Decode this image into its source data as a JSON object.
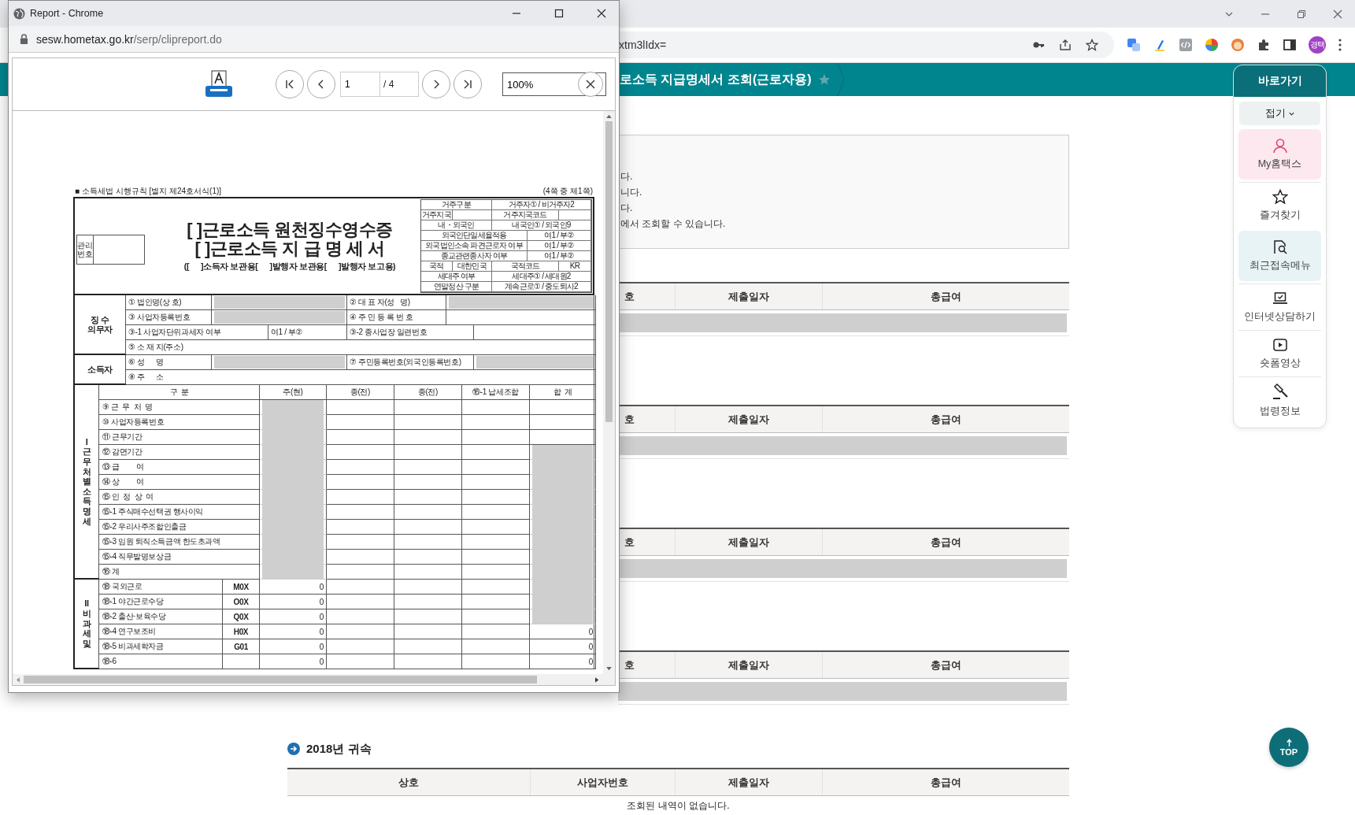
{
  "browser": {
    "address": "xtm3lIdx=",
    "profile": "경택"
  },
  "page": {
    "title": "로소득 지급명세서 조회(근로자용)",
    "notice_lines": [
      "다.",
      "니다.",
      "다.",
      "에서 조회할 수 있습니다."
    ],
    "tables": [
      {
        "columns": [
          "호",
          "제출일자",
          "총급여"
        ],
        "rows": [
          {
            "redacted": true
          }
        ]
      },
      {
        "columns": [
          "호",
          "제출일자",
          "총급여"
        ],
        "rows": [
          {
            "redacted": true
          }
        ]
      },
      {
        "columns": [
          "호",
          "제출일자",
          "총급여"
        ],
        "rows": [
          {
            "redacted": true
          }
        ]
      },
      {
        "columns": [
          "호",
          "제출일자",
          "총급여"
        ],
        "rows": [
          {
            "redacted": true
          }
        ]
      }
    ],
    "section": {
      "title": "2018년 귀속",
      "columns": [
        "상호",
        "사업자번호",
        "제출일자",
        "총급여"
      ],
      "empty_message": "조회된 내역이 없습니다."
    }
  },
  "quick_menu": {
    "title": "바로가기",
    "toggle": "접기",
    "items": [
      {
        "kind": "person",
        "label": "My홈택스",
        "color": "#fce8ee"
      },
      {
        "kind": "star",
        "label": "즐겨찾기"
      },
      {
        "kind": "recent",
        "label": "최근접속메뉴",
        "color": "#e7f3f4"
      },
      {
        "kind": "laptop",
        "label": "인터넷상담하기"
      },
      {
        "kind": "play",
        "label": "숏폼영상"
      },
      {
        "kind": "gavel",
        "label": "법령정보"
      }
    ]
  },
  "top_button": "TOP",
  "popup": {
    "title": "Report - Chrome",
    "url_host": "sesw.hometax.go.kr",
    "url_path": "/serp/clipreport.do",
    "page_input": "1",
    "page_total": "/ 4",
    "zoom": "100%",
    "document": {
      "form_ref": "■ 소득세법 시행규칙 [별지 제24호서식(1)]",
      "page_note": "(4쪽 중 제1쪽)",
      "mgmt_label": "관리 번호",
      "titles": [
        "[ ]근로소득 원천징수영수증",
        "[ ]근로소득 지 급 명 세 서"
      ],
      "copy_line": "([      ]소득자 보관용[      ]발행자 보관용[      ]발행자 보고용)",
      "status_grid": [
        {
          "kind": "half",
          "cells": [
            "거주구분",
            "거주자① / 비거주자2"
          ]
        },
        {
          "kind": "label_pair",
          "cells": [
            "거주지국",
            "거주지국코드"
          ]
        },
        {
          "kind": "half",
          "cells": [
            "내・외국인",
            "내국인① / 외국인9"
          ]
        },
        {
          "kind": "flag",
          "cells": [
            "외국인단일세율적용",
            "여1 / 부②"
          ]
        },
        {
          "kind": "flag",
          "cells": [
            "외국법인소속 파견근로자 여부",
            "여1 / 부②"
          ]
        },
        {
          "kind": "flag",
          "cells": [
            "종교관련종사자 여부",
            "여1 / 부②"
          ]
        },
        {
          "kind": "quad",
          "cells": [
            "국적",
            "대한민국",
            "국적코드",
            "KR"
          ]
        },
        {
          "kind": "half",
          "cells": [
            "세대주 여부",
            "세대주① / 세대원2"
          ]
        },
        {
          "kind": "half",
          "cells": [
            "연말정산 구분",
            "계속근로① / 중도퇴사2"
          ]
        }
      ],
      "parties": [
        {
          "label": "징 수 의무자",
          "rows": [
            {
              "kind": "pair",
              "cells": [
                {
                  "text": "① 법인명(상 호)"
                },
                {
                  "redacted": true
                },
                {
                  "text": "② 대 표 자(성   명)"
                },
                {
                  "redacted": true
                }
              ]
            },
            {
              "kind": "pair",
              "cells": [
                {
                  "text": "③ 사업자등록번호"
                },
                {
                  "redacted": true
                },
                {
                  "text": "④ 주 민 등 록 번 호"
                },
                {
                  "redacted": false
                }
              ]
            },
            {
              "kind": "flag",
              "cells": [
                {
                  "text": "③-1 사업자단위과세자 여부"
                },
                {
                  "text": "여1 / 부②"
                },
                {
                  "text": "③-2 종사업장 일련번호"
                },
                {
                  "redacted": false
                }
              ]
            },
            {
              "kind": "wide",
              "cells": [
                {
                  "text": "⑤ 소 재 지(주소)"
                }
              ]
            }
          ]
        },
        {
          "label": "소득자",
          "rows": [
            {
              "kind": "person",
              "cells": [
                {
                  "text": "⑥ 성      명"
                },
                {
                  "redacted": true
                },
                {
                  "text": "⑦ 주민등록번호(외국인등록번호)"
                },
                {
                  "redacted": true
                }
              ]
            },
            {
              "kind": "wide",
              "cells": [
                {
                  "text": "⑧ 주      소"
                }
              ]
            }
          ]
        }
      ],
      "income": {
        "columns": [
          "구  분",
          "주(현)",
          "종(전)",
          "종(전)",
          "⑯-1 납세조합",
          "합  계"
        ],
        "sections": [
          {
            "label": "I 근무처별소득명세",
            "coded": false,
            "rows": [
              {
                "item": "⑨ 근  무  처  명",
                "current_redacted": true,
                "total_redacted": false
              },
              {
                "item": "⑩ 사업자등록번호",
                "current_redacted": true,
                "total_redacted": false
              },
              {
                "item": "⑪ 근무기간",
                "current_redacted": true,
                "total_redacted": false
              },
              {
                "item": "⑫ 감면기간",
                "current_redacted": true,
                "total_redacted": true
              },
              {
                "item": "⑬ 급         여",
                "current_redacted": true,
                "total_redacted": true
              },
              {
                "item": "⑭ 상         여",
                "current_redacted": true,
                "total_redacted": true
              },
              {
                "item": "⑮ 인  정  상  여",
                "current_redacted": true,
                "total_redacted": true
              },
              {
                "item": "⑮-1 주식매수선택권 행사이익",
                "current_redacted": true,
                "total_redacted": true
              },
              {
                "item": "⑮-2 우리사주조합인출금",
                "current_redacted": true,
                "total_redacted": true
              },
              {
                "item": "⑮-3 임원 퇴직소득금액 한도초과액",
                "current_redacted": true,
                "total_redacted": true
              },
              {
                "item": "⑮-4 직무발명보상금",
                "current_redacted": true,
                "total_redacted": true
              },
              {
                "item": "⑯ 계",
                "current_redacted": true,
                "total_redacted": true
              }
            ]
          },
          {
            "label": "II 비과세및",
            "coded": true,
            "rows": [
              {
                "item": "⑱ 국외근로",
                "code": "M0X",
                "current": "0",
                "current_redacted": false,
                "total_redacted": true
              },
              {
                "item": "⑱-1 야간근로수당",
                "code": "O0X",
                "current": "0",
                "current_redacted": false,
                "total_redacted": true
              },
              {
                "item": "⑱-2 출산·보육수당",
                "code": "Q0X",
                "current": "0",
                "current_redacted": false,
                "total_redacted": true
              },
              {
                "item": "⑱-4 연구보조비",
                "code": "H0X",
                "current": "0",
                "current_redacted": false,
                "total": "0",
                "total_redacted": false
              },
              {
                "item": "⑱-5 비과세학자금",
                "code": "G01",
                "current": "0",
                "current_redacted": false,
                "total": "0",
                "total_redacted": false
              },
              {
                "item": "⑱-6",
                "current": "0",
                "current_redacted": false,
                "total": "0",
                "total_redacted": false
              }
            ]
          }
        ]
      }
    }
  }
}
